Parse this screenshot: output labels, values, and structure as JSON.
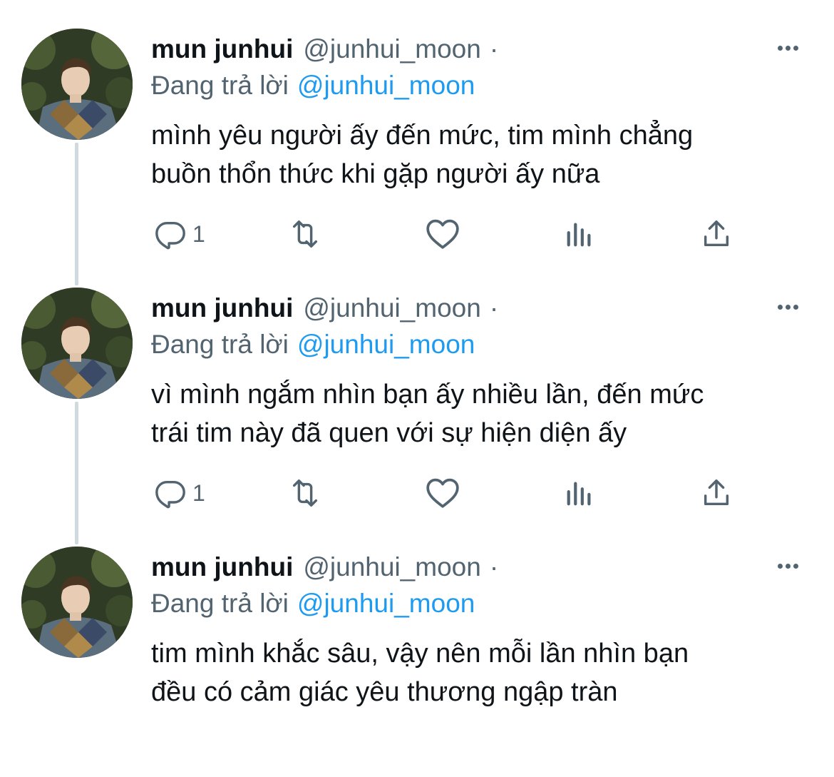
{
  "colors": {
    "text_primary": "#0f1419",
    "text_secondary": "#536471",
    "mention_blue": "#1d9bf0",
    "thread_line": "#cfd9de",
    "icon_gray": "#536471"
  },
  "icons": {
    "reply": "reply-icon",
    "retweet": "retweet-icon",
    "like": "heart-icon",
    "analytics": "analytics-icon",
    "share": "share-icon",
    "more": "more-icon"
  },
  "tweets": [
    {
      "author_name": "mun junhui",
      "author_handle": "@junhui_moon",
      "separator": "·",
      "reply_label": "Đang trả lời",
      "reply_mention": "@junhui_moon",
      "text_lines": [
        "mình yêu người ấy đến mức, tim mình chẳng",
        "buồn thổn thức khi gặp người ấy nữa"
      ],
      "reply_count": "1"
    },
    {
      "author_name": "mun junhui",
      "author_handle": "@junhui_moon",
      "separator": "·",
      "reply_label": "Đang trả lời",
      "reply_mention": "@junhui_moon",
      "text_lines": [
        "vì mình ngắm nhìn bạn ấy nhiều lần, đến mức",
        "trái tim này đã quen với sự hiện diện ấy"
      ],
      "reply_count": "1"
    },
    {
      "author_name": "mun junhui",
      "author_handle": "@junhui_moon",
      "separator": "·",
      "reply_label": "Đang trả lời",
      "reply_mention": "@junhui_moon",
      "text_lines": [
        "tim mình khắc sâu, vậy nên mỗi lần nhìn bạn",
        "đều có cảm giác yêu thương ngập tràn"
      ]
    }
  ]
}
